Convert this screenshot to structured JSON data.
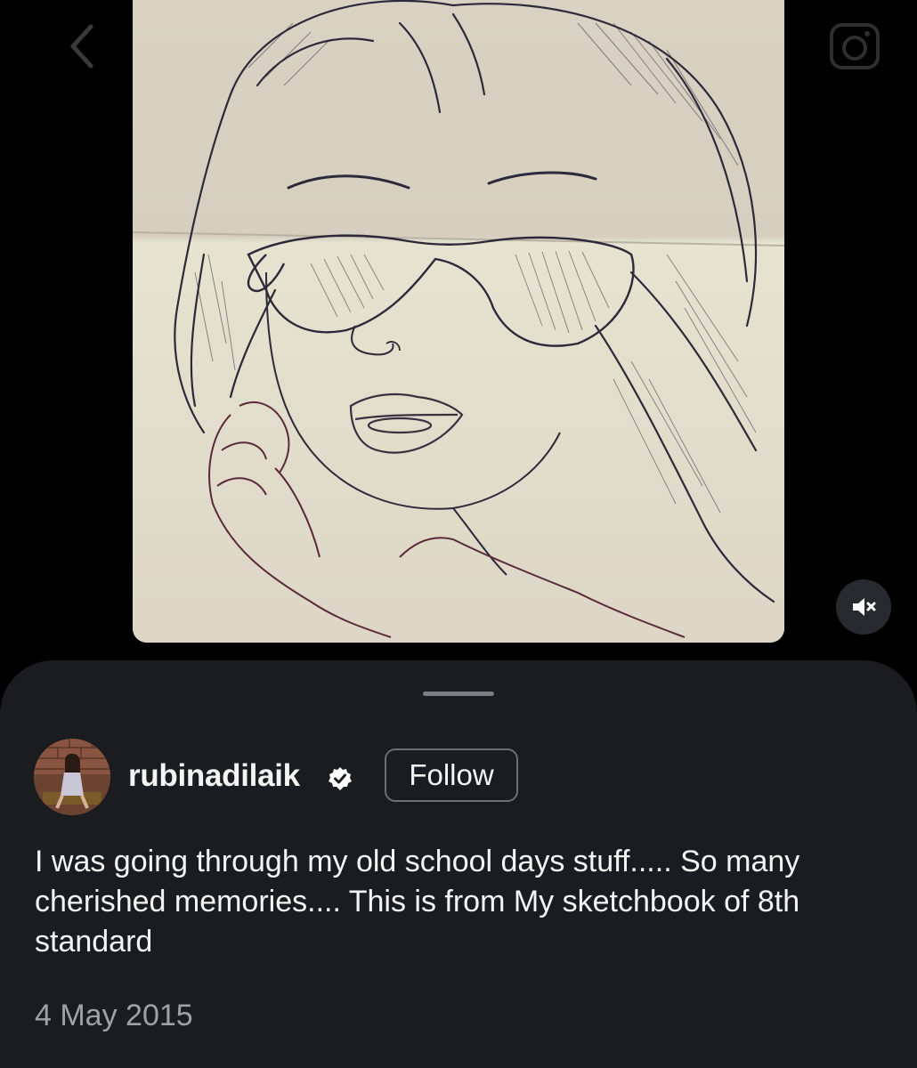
{
  "navigation": {
    "back_icon": "chevron-left-icon",
    "camera_icon": "camera-icon"
  },
  "media": {
    "description_icon": "pencil-sketch-image",
    "mute_icon": "speaker-muted-icon"
  },
  "post": {
    "username": "rubinadilaik",
    "verified": true,
    "follow_label": "Follow",
    "caption": "I was going through my old school days stuff..... So many cherished memories.... This is from My sketchbook of 8th standard",
    "date": "4 May 2015"
  },
  "colors": {
    "background": "#000000",
    "sheet": "#1a1c1f",
    "text": "#f4f4f5",
    "muted_text": "#9ea1a6",
    "follow_border": "#6b6e73"
  }
}
